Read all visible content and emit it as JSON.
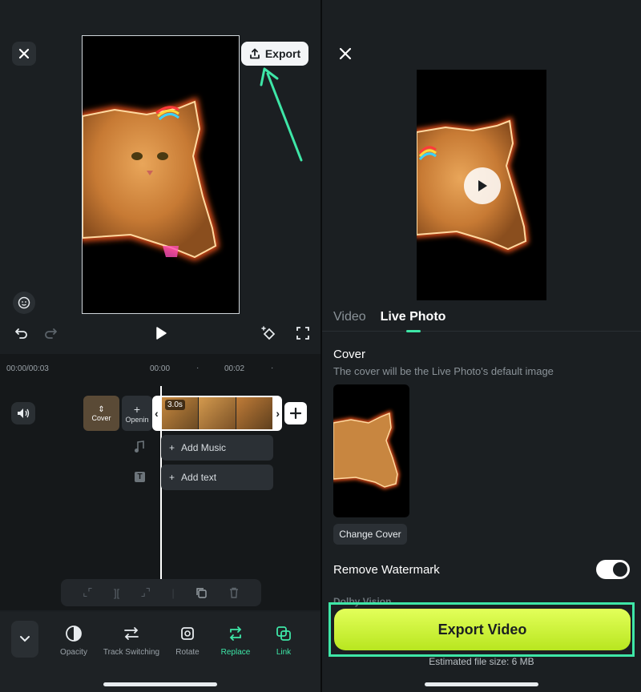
{
  "left": {
    "export_label": "Export",
    "timeline": {
      "current_time": "00:00/00:03",
      "tick_0": "00:00",
      "tick_1": "00:02",
      "dot": "·",
      "cover_label": "Cover",
      "opening_label": "Openin",
      "clip_duration": "3.0s",
      "add_music_label": "Add Music",
      "add_text_label": "Add text"
    },
    "tools": [
      {
        "label": "Opacity",
        "icon": "opacity-icon"
      },
      {
        "label": "Track Switching",
        "icon": "track-switch-icon"
      },
      {
        "label": "Rotate",
        "icon": "rotate-icon"
      },
      {
        "label": "Replace",
        "icon": "replace-icon"
      },
      {
        "label": "Link",
        "icon": "link-icon"
      }
    ],
    "active_tool": "Replace"
  },
  "right": {
    "tabs": [
      "Video",
      "Live Photo"
    ],
    "active_tab": "Live Photo",
    "cover_title": "Cover",
    "cover_desc": "The cover will be the Live Photo's default image",
    "change_cover_label": "Change Cover",
    "remove_watermark_label": "Remove Watermark",
    "remove_watermark_on": true,
    "dolby_label": "Dolby Vision",
    "export_video_label": "Export Video",
    "file_size": "Estimated file size: 6 MB"
  },
  "colors": {
    "accent": "#3ee6a7",
    "export_gradient_top": "#e3ff5a",
    "export_gradient_bottom": "#b8e61f",
    "background": "#1b1f22"
  }
}
